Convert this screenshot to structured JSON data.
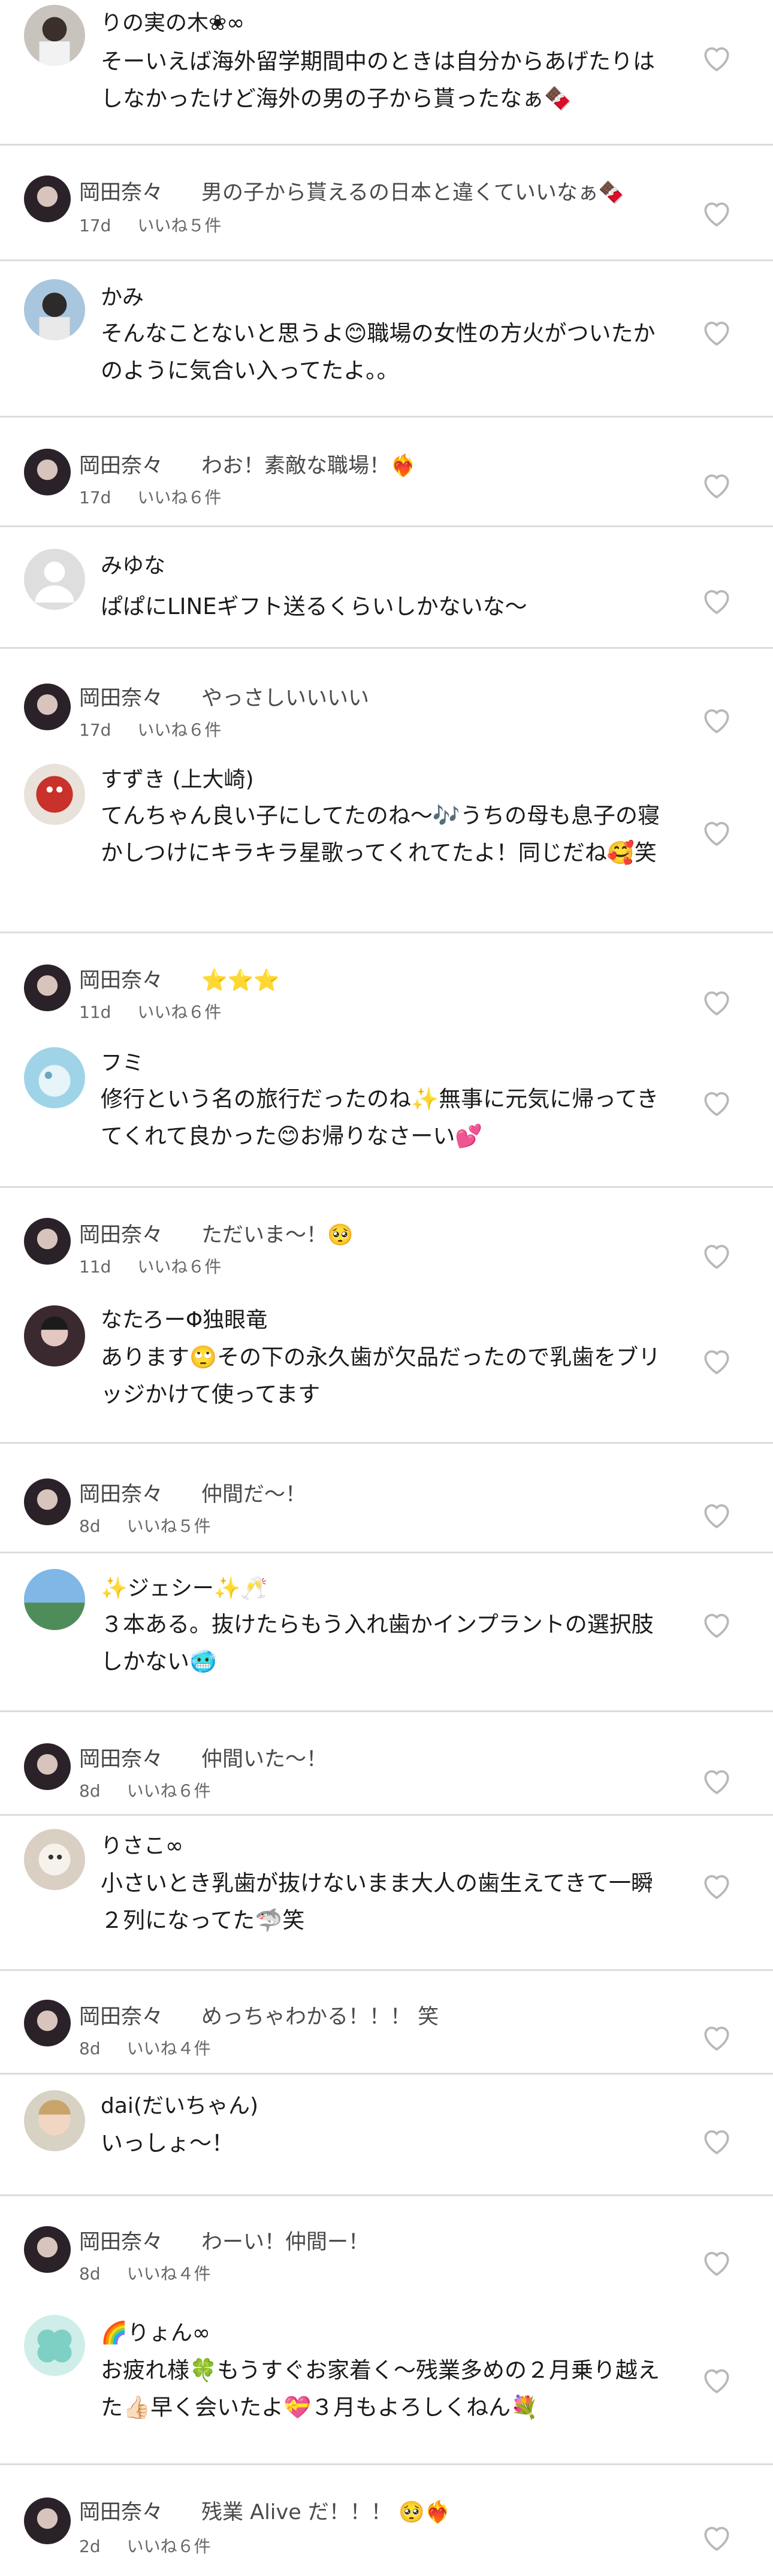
{
  "comments": [
    {
      "name": "りの実の木❀∞",
      "text": "そーいえば海外留学期間中のときは自分からあげたりはしなかったけど海外の男の子から貰ったなぁ🍫"
    },
    {
      "reply_name": "岡田奈々",
      "reply_text": "男の子から貰えるの日本と違くていいなぁ🍫",
      "time": "17d",
      "likes": "いいね５件"
    },
    {
      "name": "かみ",
      "text": "そんなことないと思うよ😊職場の女性の方火がついたかのように気合い入ってたよ。。"
    },
    {
      "reply_name": "岡田奈々",
      "reply_text": "わお！素敵な職場！❤️‍🔥",
      "time": "17d",
      "likes": "いいね６件"
    },
    {
      "name": "みゆな",
      "text": "ぱぱにLINEギフト送るくらいしかないな～"
    },
    {
      "reply_name": "岡田奈々",
      "reply_text": "やっさしいいいい",
      "time": "17d",
      "likes": "いいね６件"
    },
    {
      "name": "すずき (上大崎)",
      "text": "てんちゃん良い子にしてたのね～🎶うちの母も息子の寝かしつけにキラキラ星歌ってくれてたよ！同じだね🥰笑"
    },
    {
      "reply_name": "岡田奈々",
      "reply_text": "⭐⭐⭐",
      "time": "11d",
      "likes": "いいね６件"
    },
    {
      "name": "フミ",
      "text": "修行という名の旅行だったのね✨無事に元気に帰ってきてくれて良かった😊お帰りなさーい💕"
    },
    {
      "reply_name": "岡田奈々",
      "reply_text": "ただいま～！🥺",
      "time": "11d",
      "likes": "いいね６件"
    },
    {
      "name": "なたろーΦ独眼竜",
      "text": "あります🙄その下の永久歯が欠品だったので乳歯をブリッジかけて使ってます"
    },
    {
      "reply_name": "岡田奈々",
      "reply_text": "仲間だ～！",
      "time": "8d",
      "likes": "いいね５件"
    },
    {
      "name": "✨ジェシー✨🥂",
      "text": "３本ある。抜けたらもう入れ歯かインプラントの選択肢しかない🥶"
    },
    {
      "reply_name": "岡田奈々",
      "reply_text": "仲間いた～！",
      "time": "8d",
      "likes": "いいね６件"
    },
    {
      "name": "りさこ∞",
      "text": "小さいとき乳歯が抜けないまま大人の歯生えてきて一瞬２列になってた🦈笑"
    },
    {
      "reply_name": "岡田奈々",
      "reply_text": "めっちゃわかる！！！ 笑",
      "time": "8d",
      "likes": "いいね４件"
    },
    {
      "name": "dai(だいちゃん)",
      "text": "いっしょ～！"
    },
    {
      "reply_name": "岡田奈々",
      "reply_text": "わーい！仲間ー！",
      "time": "8d",
      "likes": "いいね４件"
    },
    {
      "name": "🌈りょん∞",
      "text": "お疲れ様🍀もうすぐお家着く～残業多めの２月乗り越えた👍🏻早く会いたよ💝３月もよろしくねん💐"
    },
    {
      "reply_name": "岡田奈々",
      "reply_text": "残業 Alive だ！！！ 🥺❤️‍🔥",
      "time": "2d",
      "likes": "いいね６件"
    }
  ],
  "icons": {
    "like": "heart-outline-icon"
  },
  "colors": {
    "separator": "#dcdcdc",
    "meta": "#666666",
    "heart": "#b8b8b8"
  }
}
